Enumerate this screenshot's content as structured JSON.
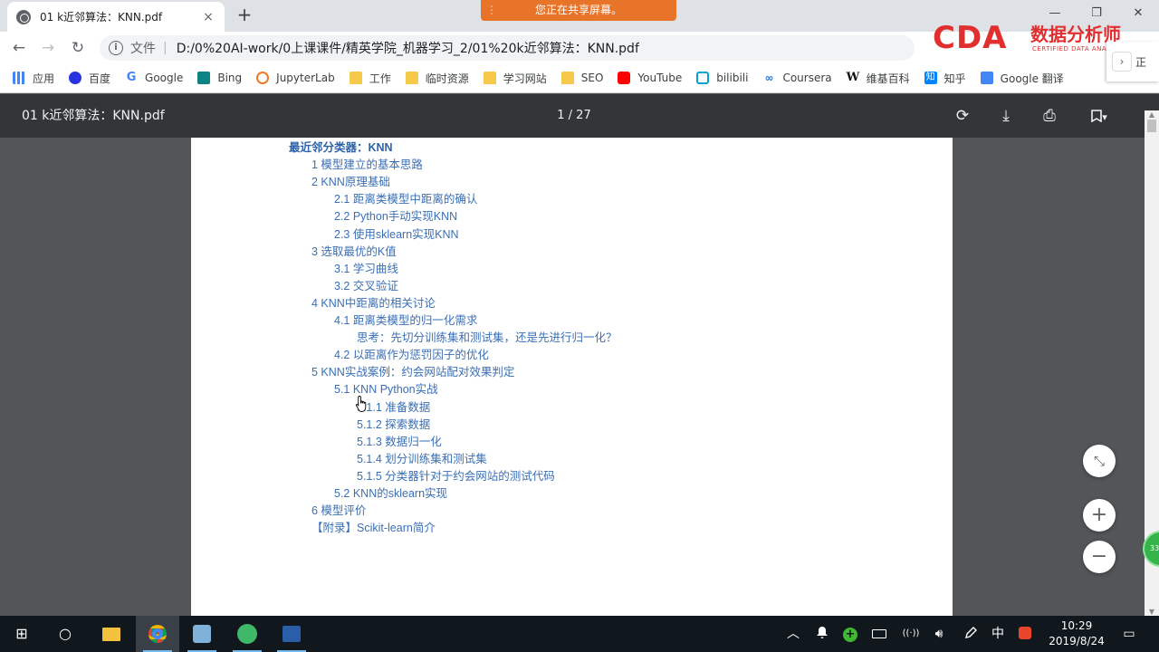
{
  "browser": {
    "tab_title": "01 k近邻算法：KNN.pdf",
    "tab_close": "×",
    "new_tab": "+",
    "share_banner": "您正在共享屏幕。",
    "share_grip": "⋮",
    "window_controls": {
      "minimize": "—",
      "restore": "❐",
      "close": "✕"
    },
    "nav": {
      "back": "←",
      "forward": "→",
      "reload": "↻"
    },
    "omnibox": {
      "info": "i",
      "label": "文件",
      "separator": "|",
      "url": "D:/0%20AI-work/0上课课件/精英学院_机器学习_2/01%20k近邻算法：KNN.pdf"
    },
    "bookmarks": [
      {
        "label": "应用",
        "icon": "apps-icon"
      },
      {
        "label": "百度",
        "icon": "baidu-icon"
      },
      {
        "label": "Google",
        "icon": "google-icon",
        "glyph": "G"
      },
      {
        "label": "Bing",
        "icon": "bing-icon"
      },
      {
        "label": "JupyterLab",
        "icon": "jupyter-icon"
      },
      {
        "label": "工作",
        "icon": "folder-icon"
      },
      {
        "label": "临时资源",
        "icon": "folder-icon"
      },
      {
        "label": "学习网站",
        "icon": "folder-icon"
      },
      {
        "label": "SEO",
        "icon": "folder-icon"
      },
      {
        "label": "YouTube",
        "icon": "youtube-icon"
      },
      {
        "label": "bilibili",
        "icon": "bilibili-icon"
      },
      {
        "label": "Coursera",
        "icon": "coursera-icon",
        "glyph": "∞"
      },
      {
        "label": "维基百科",
        "icon": "wikipedia-icon",
        "glyph": "W"
      },
      {
        "label": "知乎",
        "icon": "zhihu-icon",
        "glyph": "知"
      },
      {
        "label": "Google 翻译",
        "icon": "google-translate-icon"
      }
    ],
    "bookmark_overflow": {
      "chevron": "›",
      "text": "正"
    }
  },
  "logo": {
    "big": "CDA",
    "cn": "数据分析师",
    "en": "CERTIFIED DATA ANALYST"
  },
  "pdf": {
    "title": "01 k近邻算法：KNN.pdf",
    "page_indicator": "1 / 27",
    "actions": {
      "rotate": "⟳",
      "download": "⤓",
      "print": "⎙",
      "bookmark": "▾"
    },
    "zoom": {
      "fit": "⤡",
      "in": "+",
      "out": "−"
    },
    "side_badge": "33",
    "toc": [
      {
        "level": 0,
        "text": "最近邻分类器：KNN"
      },
      {
        "level": 1,
        "text": "1 模型建立的基本思路"
      },
      {
        "level": 1,
        "text": "2 KNN原理基础"
      },
      {
        "level": 2,
        "text": "2.1 距离类模型中距离的确认"
      },
      {
        "level": 2,
        "text": "2.2 Python手动实现KNN"
      },
      {
        "level": 2,
        "text": "2.3 使用sklearn实现KNN"
      },
      {
        "level": 1,
        "text": "3 选取最优的K值"
      },
      {
        "level": 2,
        "text": "3.1 学习曲线"
      },
      {
        "level": 2,
        "text": "3.2 交叉验证"
      },
      {
        "level": 1,
        "text": "4 KNN中距离的相关讨论"
      },
      {
        "level": 2,
        "text": "4.1 距离类模型的归一化需求"
      },
      {
        "level": 3,
        "text": "思考：先切分训练集和测试集，还是先进行归一化？"
      },
      {
        "level": 2,
        "text": "4.2 以距离作为惩罚因子的优化"
      },
      {
        "level": 1,
        "text": "5 KNN实战案例：约会网站配对效果判定"
      },
      {
        "level": 2,
        "text": "5.1 KNN Python实战"
      },
      {
        "level": 3,
        "text": "5.1.1  准备数据"
      },
      {
        "level": 3,
        "text": "5.1.2  探索数据"
      },
      {
        "level": 3,
        "text": "5.1.3 数据归一化"
      },
      {
        "level": 3,
        "text": "5.1.4 划分训练集和测试集"
      },
      {
        "level": 3,
        "text": "5.1.5 分类器针对于约会网站的测试代码"
      },
      {
        "level": 2,
        "text": "5.2  KNN的sklearn实现"
      },
      {
        "level": 1,
        "text": "6 模型评价"
      },
      {
        "level": 1,
        "text": "【附录】Scikit-learn简介"
      }
    ]
  },
  "taskbar": {
    "start": "⊞",
    "search": "○",
    "tray": {
      "chevron": "︿",
      "ime": "中",
      "wifi": "((·))",
      "volume": "🔊︎",
      "notification": "▭"
    },
    "clock_time": "10:29",
    "clock_date": "2019/8/24"
  }
}
